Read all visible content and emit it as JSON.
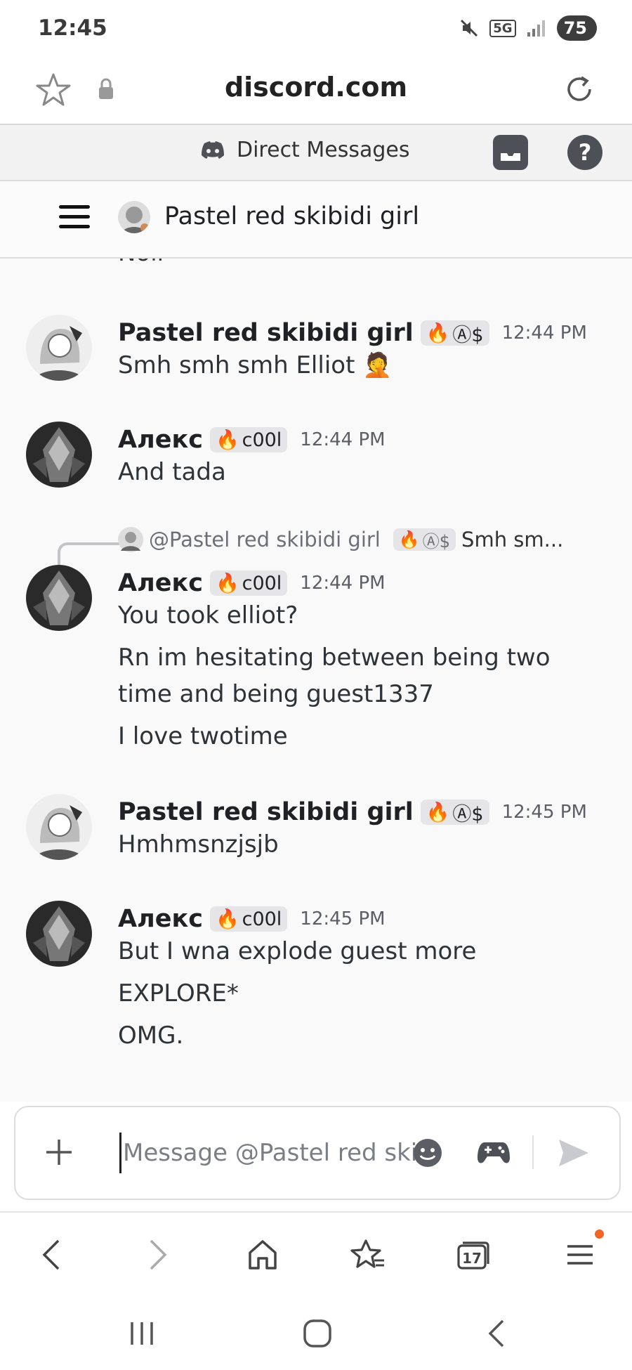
{
  "status_bar": {
    "time": "12:45",
    "battery": "75",
    "network": "5G"
  },
  "browser": {
    "url": "discord.com",
    "tab_count": "17"
  },
  "dm_header": {
    "title": "Direct Messages"
  },
  "channel": {
    "name": "Pastel red skibidi girl"
  },
  "partial_message": "Noli",
  "messages": [
    {
      "author": "Pastel red skibidi girl",
      "badge": "Ⓐ$",
      "time": "12:44 PM",
      "lines": [
        "Smh smh smh Elliot 🤦"
      ]
    },
    {
      "author": "Алекс",
      "badge": "c00l",
      "time": "12:44 PM",
      "lines": [
        "And tada"
      ]
    },
    {
      "author": "Алекс",
      "badge": "c00l",
      "time": "12:44 PM",
      "reply": {
        "author": "@Pastel red skibidi girl",
        "badge": "Ⓐ$",
        "text": "Smh sm..."
      },
      "lines": [
        "You took elliot?",
        "Rn im hesitating between being two",
        "time and being guest1337",
        "I love twotime"
      ]
    },
    {
      "author": "Pastel red skibidi girl",
      "badge": "Ⓐ$",
      "time": "12:45 PM",
      "lines": [
        "Hmhmsnzjsjb"
      ]
    },
    {
      "author": "Алекс",
      "badge": "c00l",
      "time": "12:45 PM",
      "lines": [
        "But I wna explode guest more",
        "EXPLORE*",
        "OMG."
      ]
    }
  ],
  "composer": {
    "placeholder": "Message @Pastel red skibidi girl"
  },
  "colors": {
    "accent_dot": "#f26522",
    "header_bg": "#f2f2f3",
    "send_disabled": "#c8cacf"
  }
}
